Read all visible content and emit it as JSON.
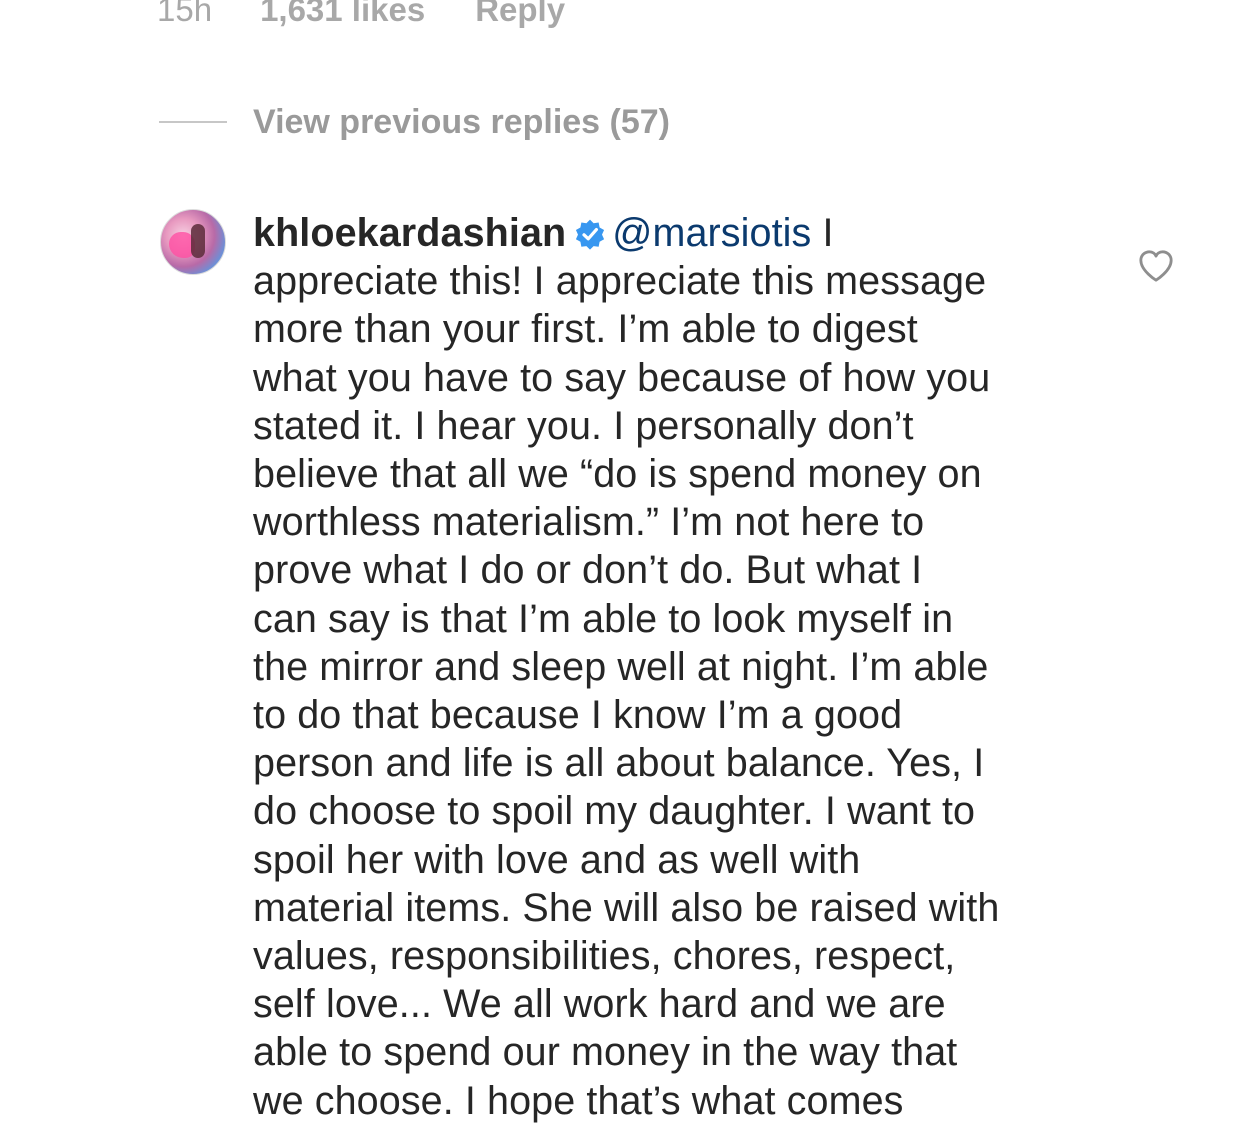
{
  "meta": {
    "time": "15h",
    "likes": "1,631 likes",
    "reply": "Reply"
  },
  "thread": {
    "view_previous": "View previous replies (57)"
  },
  "comment": {
    "username": "khloekardashian",
    "mention": "@marsiotis",
    "first_line_tail": " I",
    "lines": [
      "appreciate this! I appreciate this message",
      "more than your first. I’m able to digest",
      "what you have to say because of how you",
      "stated it. I hear you. I personally don’t",
      "believe that all we “do is spend money on",
      "worthless materialism.” I’m not here to",
      "prove what I do or don’t do. But what I",
      "can say is that I’m able to look myself in",
      "the mirror and sleep well at night. I’m able",
      "to do that because I know I’m a good",
      "person and life is all about balance. Yes, I",
      "do choose to spoil my daughter. I want to",
      "spoil her with love and as well with",
      "material items. She will also be raised with",
      "values, responsibilities, chores, respect,",
      "self love... We all work hard and we are",
      "able to spend our money in the way that",
      "we choose. I hope that’s what comes"
    ]
  },
  "icons": {
    "verified": "verified-badge-icon",
    "like": "heart-icon"
  },
  "colors": {
    "text": "#262626",
    "muted": "#a8a8a8",
    "mention": "#0b3a6e",
    "verified": "#3897f0"
  }
}
